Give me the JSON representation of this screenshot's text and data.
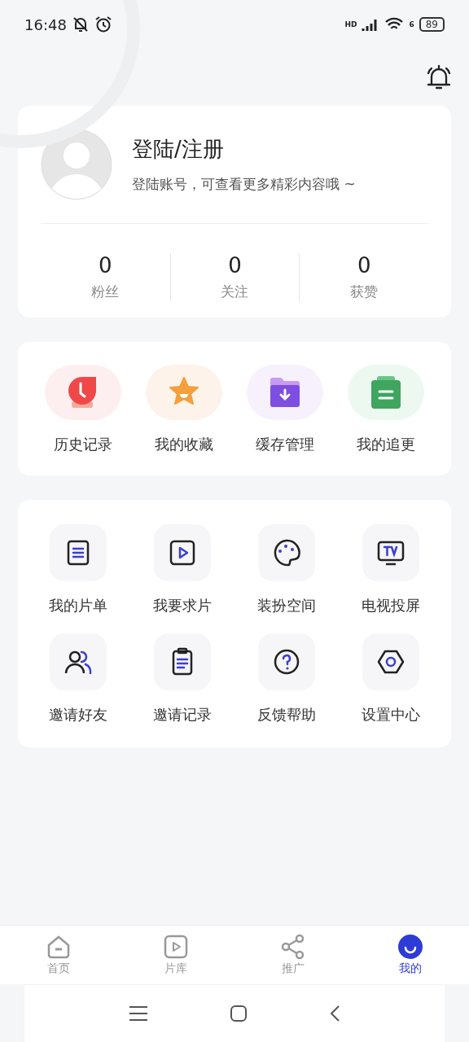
{
  "status_bar": {
    "time": "16:48",
    "signal_label": "HD",
    "wifi_label": "6",
    "battery": "89"
  },
  "profile": {
    "title": "登陆/注册",
    "subtitle": "登陆账号，可查看更多精彩内容哦 ~",
    "stats": [
      {
        "value": "0",
        "label": "粉丝"
      },
      {
        "value": "0",
        "label": "关注"
      },
      {
        "value": "0",
        "label": "获赞"
      }
    ]
  },
  "quick_actions": [
    {
      "label": "历史记录",
      "color": "#fdeff0"
    },
    {
      "label": "我的收藏",
      "color": "#fdf3ea"
    },
    {
      "label": "缓存管理",
      "color": "#f6f1fc"
    },
    {
      "label": "我的追更",
      "color": "#edf8f1"
    }
  ],
  "services": [
    {
      "label": "我的片单"
    },
    {
      "label": "我要求片"
    },
    {
      "label": "装扮空间"
    },
    {
      "label": "电视投屏"
    },
    {
      "label": "邀请好友"
    },
    {
      "label": "邀请记录"
    },
    {
      "label": "反馈帮助"
    },
    {
      "label": "设置中心"
    }
  ],
  "tabs": [
    {
      "label": "首页",
      "selected": false
    },
    {
      "label": "片库",
      "selected": false
    },
    {
      "label": "推广",
      "selected": false
    },
    {
      "label": "我的",
      "selected": true
    }
  ]
}
